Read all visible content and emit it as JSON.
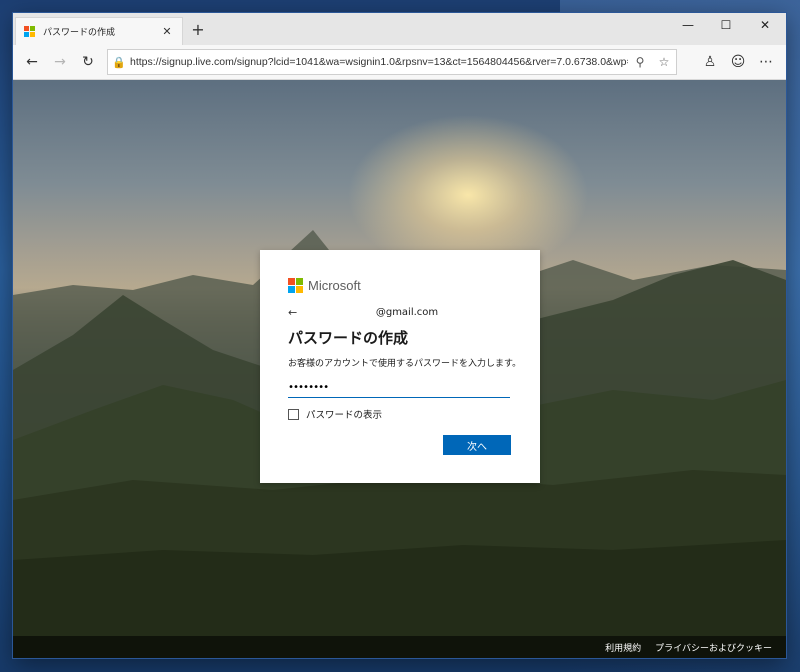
{
  "tab": {
    "title": "パスワードの作成",
    "close_glyph": "✕"
  },
  "new_tab_glyph": "+",
  "window_controls": {
    "minimize": "—",
    "maximize": "☐",
    "close": "✕"
  },
  "toolbar": {
    "back_glyph": "←",
    "forward_glyph": "→",
    "refresh_glyph": "↻",
    "lock_glyph": "🔒",
    "url": "https://signup.live.com/signup?lcid=1041&wa=wsignin1.0&rpsnv=13&ct=1564804456&rver=7.0.6738.0&wp=...",
    "key_glyph": "⚲",
    "favorite_glyph": "☆",
    "profile_glyph": "♙",
    "emoji_glyph": "☺",
    "more_glyph": "⋯"
  },
  "brand": {
    "name": "Microsoft",
    "colors": [
      "#f25022",
      "#7fba00",
      "#00a4ef",
      "#ffb900"
    ]
  },
  "card": {
    "back_glyph": "←",
    "email": "@gmail.com",
    "title": "パスワードの作成",
    "description": "お客様のアカウントで使用するパスワードを入力します。",
    "password_value": "••••••••",
    "show_password_label": "パスワードの表示",
    "show_password_checked": false,
    "next_label": "次へ"
  },
  "footer": {
    "terms": "利用規約",
    "privacy": "プライバシーおよびクッキー"
  },
  "colors": {
    "accent": "#0067b8",
    "card_bg": "#ffffff"
  }
}
